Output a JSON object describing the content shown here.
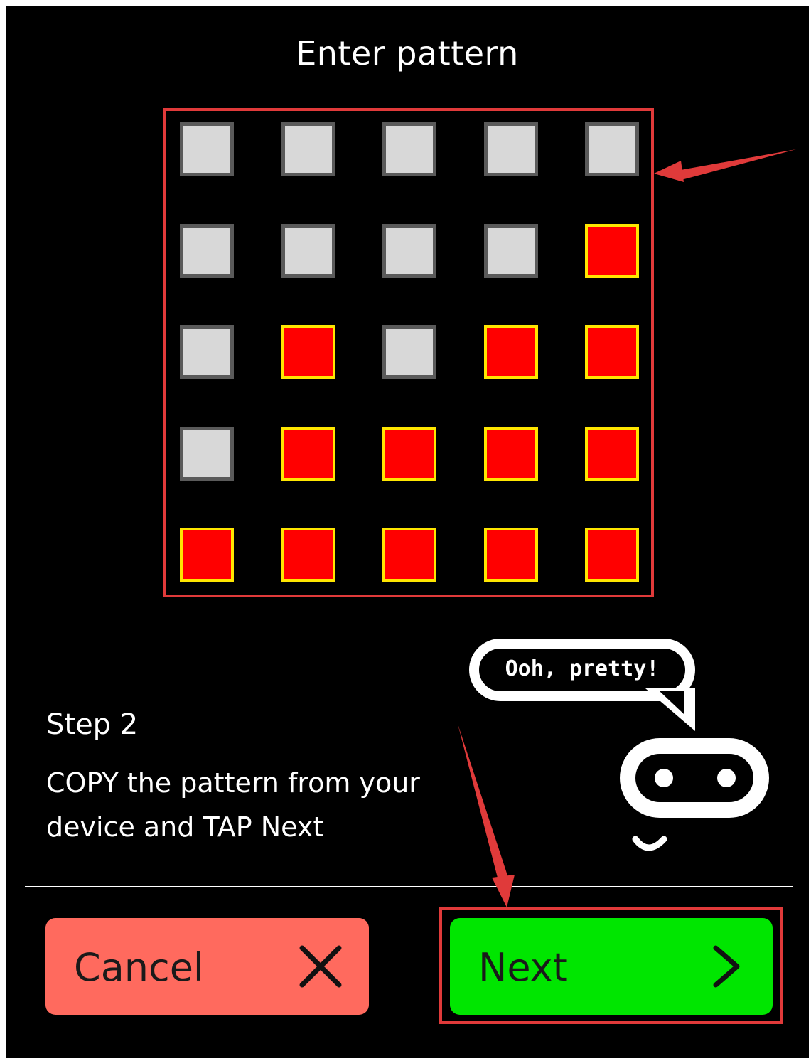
{
  "header": {
    "title": "Enter pattern"
  },
  "pattern": {
    "rows": [
      [
        0,
        0,
        0,
        0,
        0
      ],
      [
        0,
        0,
        0,
        0,
        1
      ],
      [
        0,
        1,
        0,
        1,
        1
      ],
      [
        0,
        1,
        1,
        1,
        1
      ],
      [
        1,
        1,
        1,
        1,
        1
      ]
    ],
    "on_color": "#ff0000",
    "on_border_color": "#ffe600",
    "off_color": "#d8d8d8"
  },
  "mascot": {
    "speech": "Ooh, pretty!"
  },
  "instructions": {
    "step": "Step 2",
    "text": "COPY the pattern from your device and TAP Next"
  },
  "buttons": {
    "cancel": {
      "label": "Cancel",
      "icon": "close-icon",
      "color": "#ff6a5e"
    },
    "next": {
      "label": "Next",
      "icon": "chevron-right-icon",
      "color": "#00e600"
    }
  },
  "annotations": {
    "highlight_color": "#e03a3a"
  }
}
